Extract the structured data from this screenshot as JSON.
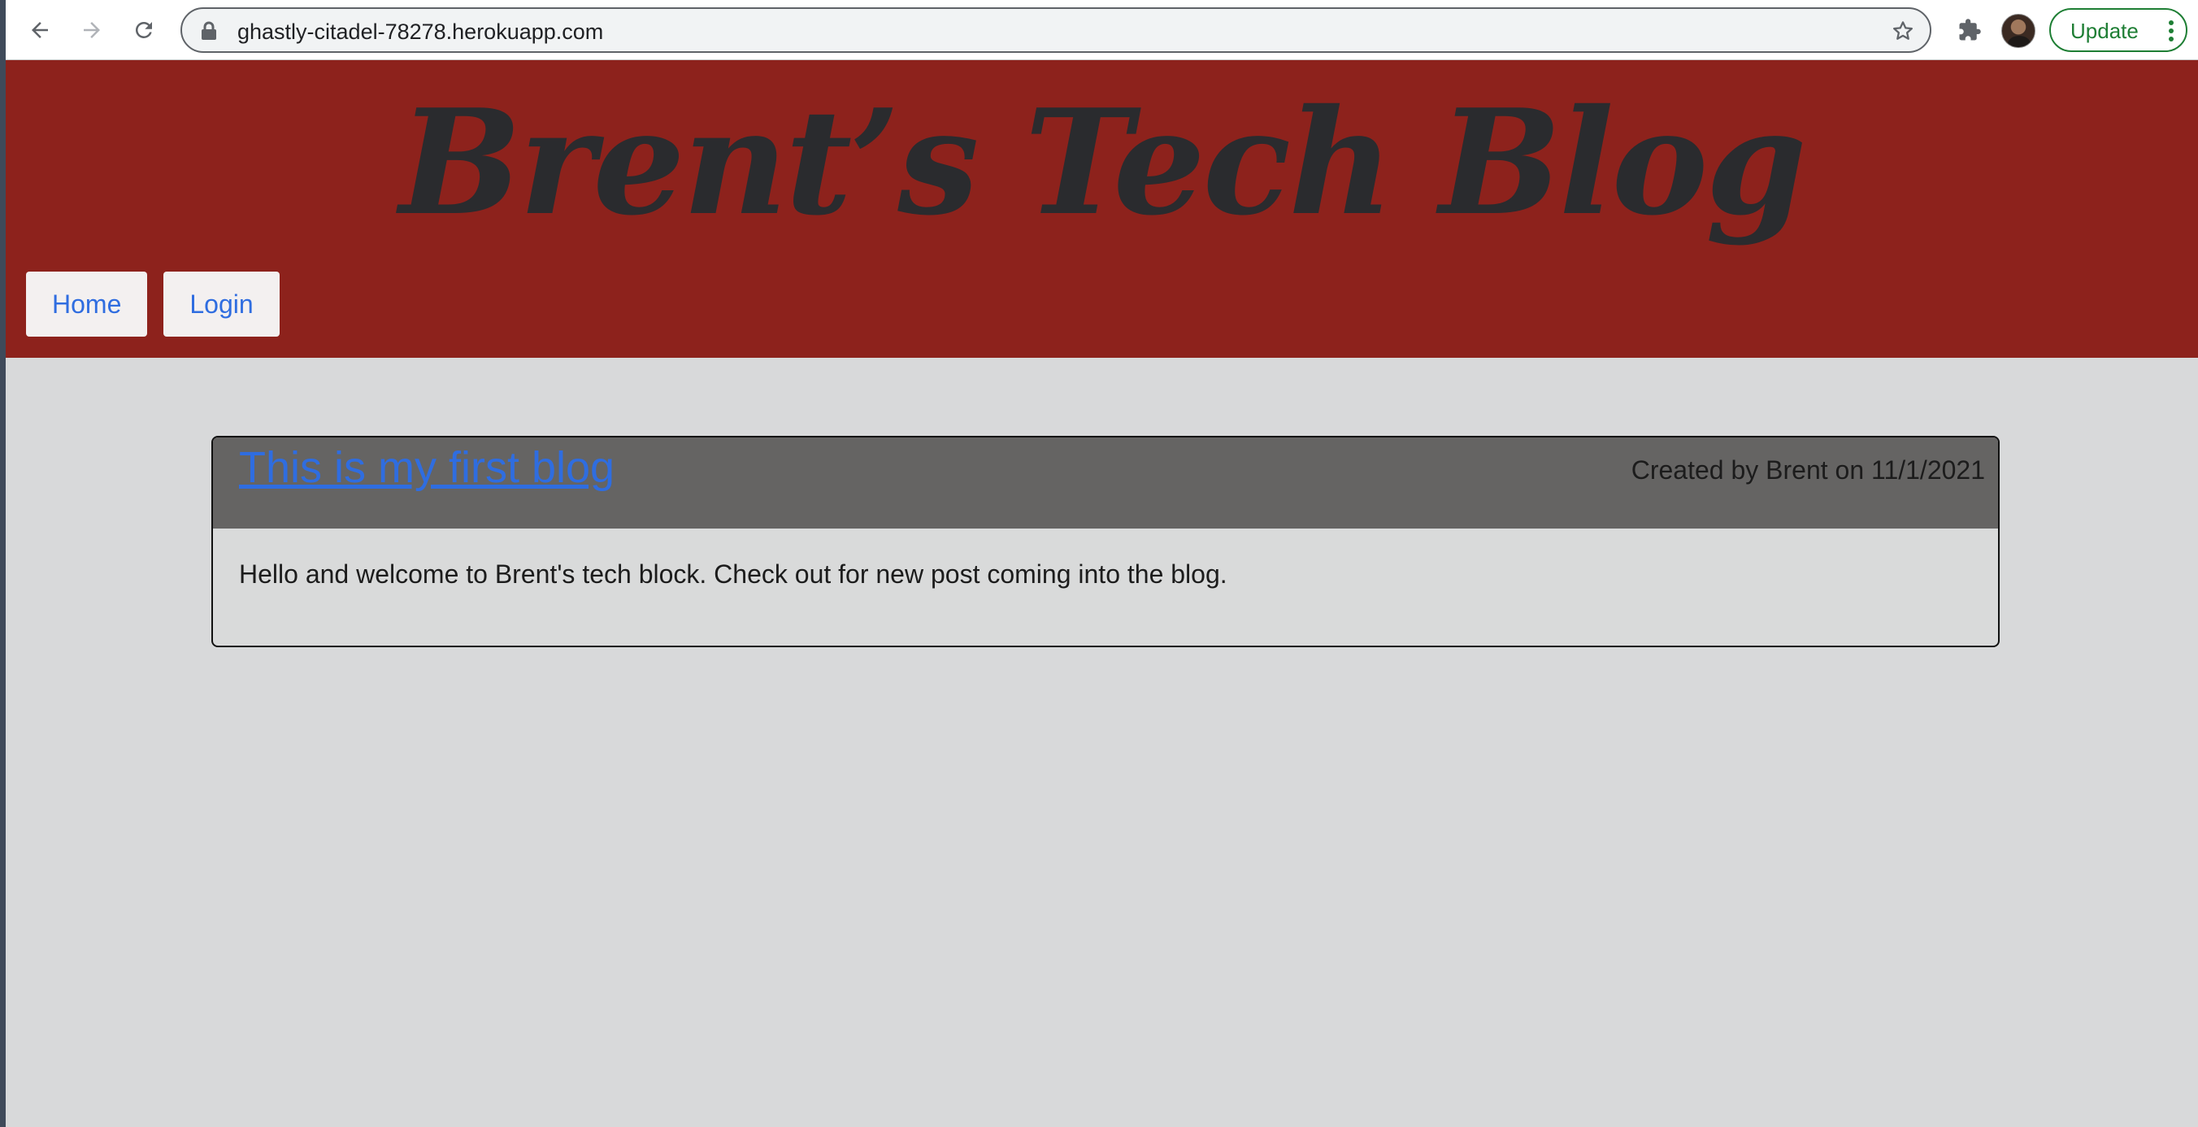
{
  "browser": {
    "url": "ghastly-citadel-78278.herokuapp.com",
    "update_label": "Update"
  },
  "site": {
    "title": "Brent’s Tech Blog",
    "nav": [
      {
        "label": "Home"
      },
      {
        "label": "Login"
      }
    ]
  },
  "posts": [
    {
      "title": "This is my first blog",
      "meta": "Created by Brent on 11/1/2021",
      "body": "Hello and welcome to Brent's tech block. Check out for new post coming into the blog."
    }
  ],
  "colors": {
    "header_bg": "#8d221c",
    "page_bg": "#d8d9da",
    "card_header_bg": "#656463",
    "link": "#2f6de0",
    "update_green": "#1e7e34"
  },
  "icons": [
    "back-arrow-icon",
    "forward-arrow-icon",
    "reload-icon",
    "lock-icon",
    "star-icon",
    "puzzle-icon",
    "kebab-menu-icon"
  ]
}
